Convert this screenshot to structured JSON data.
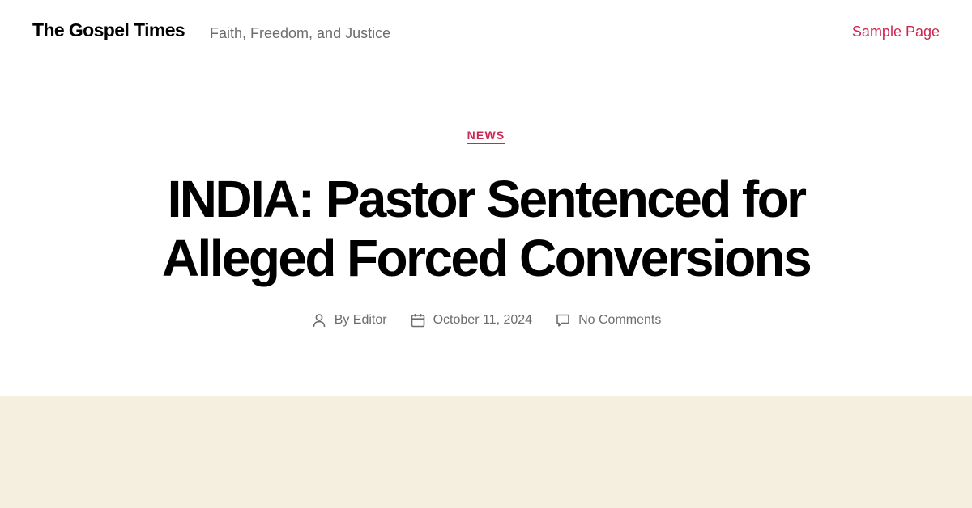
{
  "site": {
    "title": "The Gospel Times",
    "description": "Faith, Freedom, and Justice"
  },
  "menu": {
    "items": [
      {
        "label": "Sample Page"
      }
    ]
  },
  "post": {
    "category": "NEWS",
    "title_lines": [
      "INDIA: Pastor Sentenced for",
      "Alleged Forced Conversions"
    ],
    "meta": {
      "author": "By Editor",
      "date": "October 11, 2024",
      "comments": "No Comments"
    }
  },
  "icons": {
    "author": "person-icon",
    "date": "calendar-icon",
    "comments": "speech-bubble-icon"
  },
  "colors": {
    "accent": "#cd2653",
    "text": "#000000",
    "secondary_text": "#6d6d6d",
    "featured_background": "#f5efe0"
  }
}
